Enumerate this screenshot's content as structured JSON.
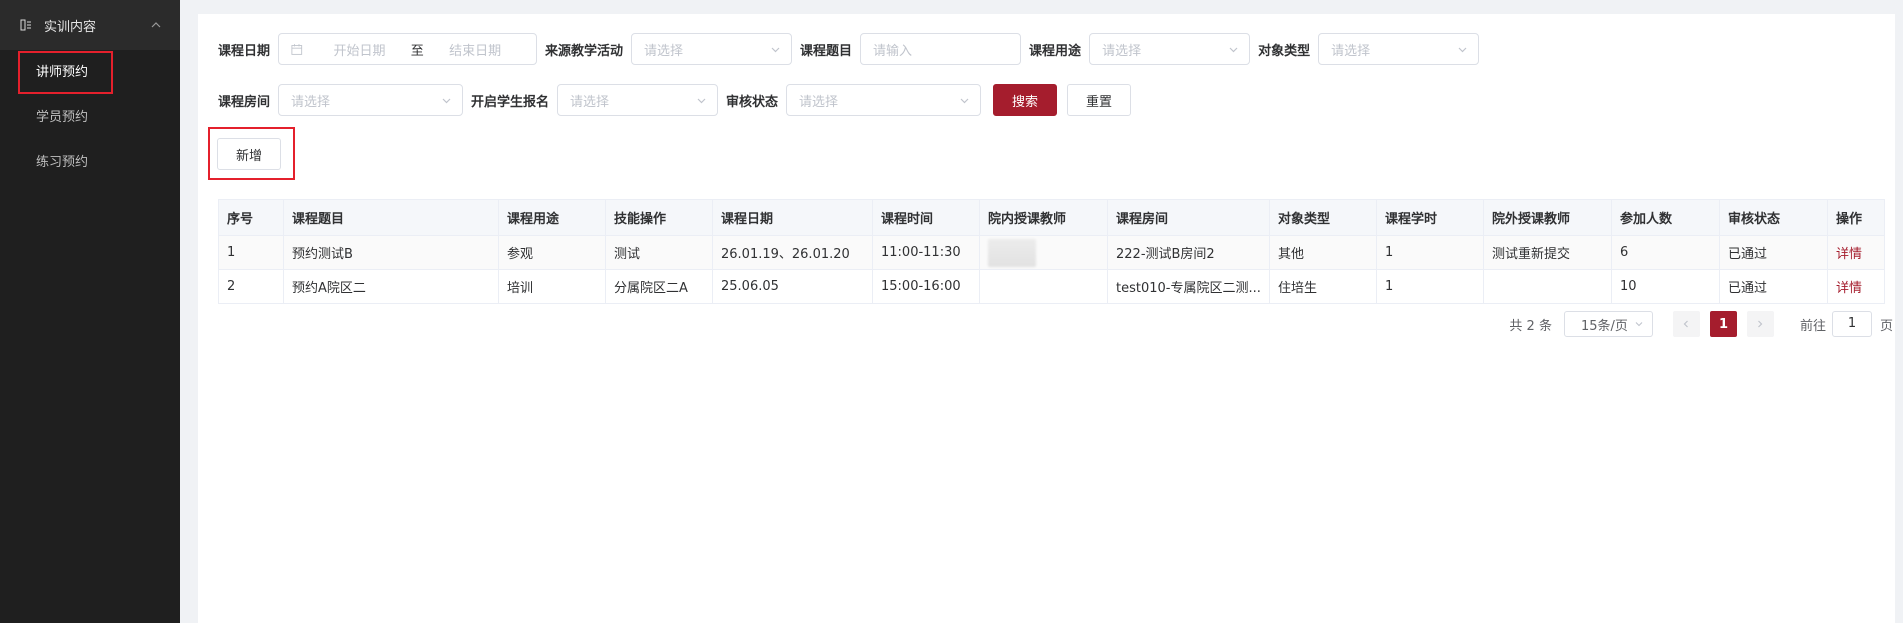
{
  "sidebar": {
    "group_label": "实训内容",
    "items": [
      {
        "label": "讲师预约",
        "active": true
      },
      {
        "label": "学员预约",
        "active": false
      },
      {
        "label": "练习预约",
        "active": false
      }
    ]
  },
  "filters": {
    "course_date_label": "课程日期",
    "start_placeholder": "开始日期",
    "range_sep": "至",
    "end_placeholder": "结束日期",
    "source_label": "来源教学活动",
    "source_placeholder": "请选择",
    "topic_label": "课程题目",
    "topic_placeholder": "请输入",
    "purpose_label": "课程用途",
    "purpose_placeholder": "请选择",
    "target_label": "对象类型",
    "target_placeholder": "请选择",
    "room_label": "课程房间",
    "room_placeholder": "请选择",
    "enroll_label": "开启学生报名",
    "enroll_placeholder": "请选择",
    "audit_label": "审核状态",
    "audit_placeholder": "请选择",
    "search_btn": "搜索",
    "reset_btn": "重置"
  },
  "toolbar": {
    "add_btn": "新增"
  },
  "table": {
    "columns": [
      "序号",
      "课程题目",
      "课程用途",
      "技能操作",
      "课程日期",
      "课程时间",
      "院内授课教师",
      "课程房间",
      "对象类型",
      "课程学时",
      "院外授课教师",
      "参加人数",
      "审核状态",
      "操作"
    ],
    "rows": [
      {
        "no": "1",
        "topic": "预约测试B",
        "purpose": "参观",
        "skill": "测试",
        "date": "26.01.19、26.01.20",
        "time": "11:00-11:30",
        "room": "222-测试B房间2",
        "target": "其他",
        "hours": "1",
        "external": "测试重新提交",
        "count": "6",
        "status": "已通过",
        "action": "详情"
      },
      {
        "no": "2",
        "topic": "预约A院区二",
        "purpose": "培训",
        "skill": "分属院区二A",
        "date": "25.06.05",
        "time": "15:00-16:00",
        "room": "test010-专属院区二测...",
        "target": "住培生",
        "hours": "1",
        "external": "",
        "count": "10",
        "status": "已通过",
        "action": "详情"
      }
    ]
  },
  "pagination": {
    "total": "共 2 条",
    "page_size": "15条/页",
    "current": "1",
    "goto_prefix": "前往",
    "goto_value": "1",
    "goto_suffix": "页"
  },
  "colors": {
    "brand": "#a51d2d",
    "sidebar_bg": "#1f1f1f",
    "highlight": "#e4202c"
  }
}
